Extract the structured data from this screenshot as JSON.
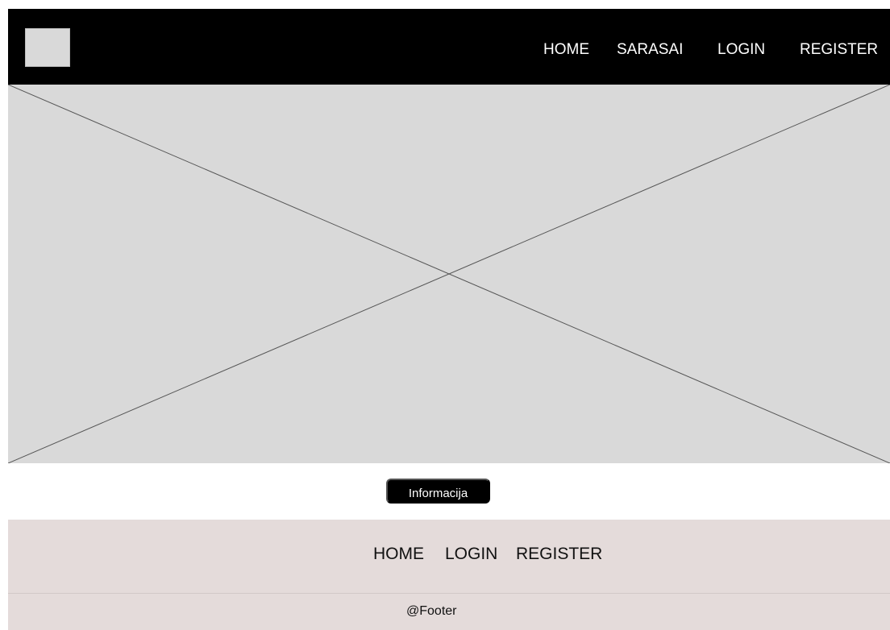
{
  "header": {
    "logo_placeholder": "logo-placeholder",
    "nav": {
      "home": "HOME",
      "sarasai": "SARASAI",
      "login": "LOGIN",
      "register": "REGISTER"
    }
  },
  "hero": {
    "placeholder": "image-placeholder"
  },
  "content": {
    "info_button": "Informacija"
  },
  "footer": {
    "nav": {
      "home": "HOME",
      "login": "LOGIN",
      "register": "REGISTER"
    },
    "copyright": "@Footer"
  },
  "colors": {
    "header_bg": "#000000",
    "header_text": "#ffffff",
    "placeholder_bg": "#d9d9d9",
    "placeholder_line": "#555555",
    "button_bg": "#000000",
    "button_text": "#ffffff",
    "footer_bg": "#e4dbda",
    "footer_text": "#111111"
  }
}
